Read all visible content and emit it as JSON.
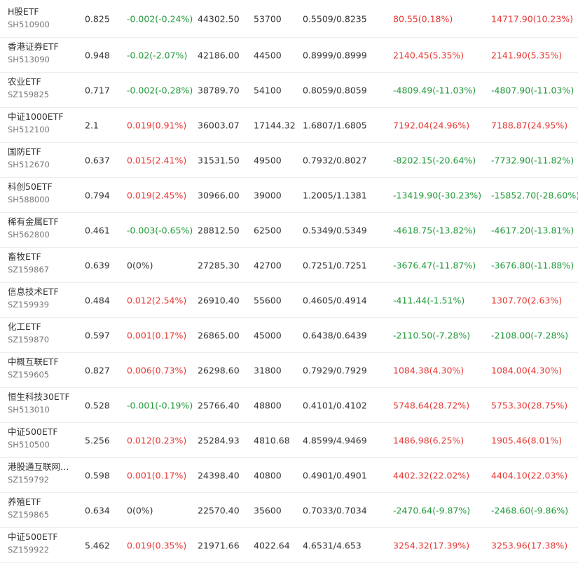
{
  "colors": {
    "up": "#e53935",
    "down": "#229a3a",
    "flat": "#333333",
    "code": "#777777",
    "divider": "#eeeeee"
  },
  "rows": [
    {
      "name": "H股ETF",
      "code": "SH510900",
      "price": "0.825",
      "change": "-0.002(-0.24%)",
      "change_dir": "down",
      "amount": "44302.50",
      "volume": "53700",
      "bid_ask": "0.5509/0.8235",
      "flow1": "80.55(0.18%)",
      "flow1_dir": "up",
      "flow2": "14717.90(10.23%)",
      "flow2_dir": "up"
    },
    {
      "name": "香港证券ETF",
      "code": "SH513090",
      "price": "0.948",
      "change": "-0.02(-2.07%)",
      "change_dir": "down",
      "amount": "42186.00",
      "volume": "44500",
      "bid_ask": "0.8999/0.8999",
      "flow1": "2140.45(5.35%)",
      "flow1_dir": "up",
      "flow2": "2141.90(5.35%)",
      "flow2_dir": "up"
    },
    {
      "name": "农业ETF",
      "code": "SZ159825",
      "price": "0.717",
      "change": "-0.002(-0.28%)",
      "change_dir": "down",
      "amount": "38789.70",
      "volume": "54100",
      "bid_ask": "0.8059/0.8059",
      "flow1": "-4809.49(-11.03%)",
      "flow1_dir": "down",
      "flow2": "-4807.90(-11.03%)",
      "flow2_dir": "down"
    },
    {
      "name": "中证1000ETF",
      "code": "SH512100",
      "price": "2.1",
      "change": "0.019(0.91%)",
      "change_dir": "up",
      "amount": "36003.07",
      "volume": "17144.32",
      "bid_ask": "1.6807/1.6805",
      "flow1": "7192.04(24.96%)",
      "flow1_dir": "up",
      "flow2": "7188.87(24.95%)",
      "flow2_dir": "up"
    },
    {
      "name": "国防ETF",
      "code": "SH512670",
      "price": "0.637",
      "change": "0.015(2.41%)",
      "change_dir": "up",
      "amount": "31531.50",
      "volume": "49500",
      "bid_ask": "0.7932/0.8027",
      "flow1": "-8202.15(-20.64%)",
      "flow1_dir": "down",
      "flow2": "-7732.90(-11.82%)",
      "flow2_dir": "down"
    },
    {
      "name": "科创50ETF",
      "code": "SH588000",
      "price": "0.794",
      "change": "0.019(2.45%)",
      "change_dir": "up",
      "amount": "30966.00",
      "volume": "39000",
      "bid_ask": "1.2005/1.1381",
      "flow1": "-13419.90(-30.23%)",
      "flow1_dir": "down",
      "flow2": "-15852.70(-28.60%)",
      "flow2_dir": "down"
    },
    {
      "name": "稀有金属ETF",
      "code": "SH562800",
      "price": "0.461",
      "change": "-0.003(-0.65%)",
      "change_dir": "down",
      "amount": "28812.50",
      "volume": "62500",
      "bid_ask": "0.5349/0.5349",
      "flow1": "-4618.75(-13.82%)",
      "flow1_dir": "down",
      "flow2": "-4617.20(-13.81%)",
      "flow2_dir": "down"
    },
    {
      "name": "畜牧ETF",
      "code": "SZ159867",
      "price": "0.639",
      "change": "0(0%)",
      "change_dir": "flat",
      "amount": "27285.30",
      "volume": "42700",
      "bid_ask": "0.7251/0.7251",
      "flow1": "-3676.47(-11.87%)",
      "flow1_dir": "down",
      "flow2": "-3676.80(-11.88%)",
      "flow2_dir": "down"
    },
    {
      "name": "信息技术ETF",
      "code": "SZ159939",
      "price": "0.484",
      "change": "0.012(2.54%)",
      "change_dir": "up",
      "amount": "26910.40",
      "volume": "55600",
      "bid_ask": "0.4605/0.4914",
      "flow1": "-411.44(-1.51%)",
      "flow1_dir": "down",
      "flow2": "1307.70(2.63%)",
      "flow2_dir": "up"
    },
    {
      "name": "化工ETF",
      "code": "SZ159870",
      "price": "0.597",
      "change": "0.001(0.17%)",
      "change_dir": "up",
      "amount": "26865.00",
      "volume": "45000",
      "bid_ask": "0.6438/0.6439",
      "flow1": "-2110.50(-7.28%)",
      "flow1_dir": "down",
      "flow2": "-2108.00(-7.28%)",
      "flow2_dir": "down"
    },
    {
      "name": "中概互联ETF",
      "code": "SZ159605",
      "price": "0.827",
      "change": "0.006(0.73%)",
      "change_dir": "up",
      "amount": "26298.60",
      "volume": "31800",
      "bid_ask": "0.7929/0.7929",
      "flow1": "1084.38(4.30%)",
      "flow1_dir": "up",
      "flow2": "1084.00(4.30%)",
      "flow2_dir": "up"
    },
    {
      "name": "恒生科技30ETF",
      "code": "SH513010",
      "price": "0.528",
      "change": "-0.001(-0.19%)",
      "change_dir": "down",
      "amount": "25766.40",
      "volume": "48800",
      "bid_ask": "0.4101/0.4102",
      "flow1": "5748.64(28.72%)",
      "flow1_dir": "up",
      "flow2": "5753.30(28.75%)",
      "flow2_dir": "up"
    },
    {
      "name": "中证500ETF",
      "code": "SH510500",
      "price": "5.256",
      "change": "0.012(0.23%)",
      "change_dir": "up",
      "amount": "25284.93",
      "volume": "4810.68",
      "bid_ask": "4.8599/4.9469",
      "flow1": "1486.98(6.25%)",
      "flow1_dir": "up",
      "flow2": "1905.46(8.01%)",
      "flow2_dir": "up"
    },
    {
      "name": "港股通互联网…",
      "code": "SZ159792",
      "price": "0.598",
      "change": "0.001(0.17%)",
      "change_dir": "up",
      "amount": "24398.40",
      "volume": "40800",
      "bid_ask": "0.4901/0.4901",
      "flow1": "4402.32(22.02%)",
      "flow1_dir": "up",
      "flow2": "4404.10(22.03%)",
      "flow2_dir": "up"
    },
    {
      "name": "养殖ETF",
      "code": "SZ159865",
      "price": "0.634",
      "change": "0(0%)",
      "change_dir": "flat",
      "amount": "22570.40",
      "volume": "35600",
      "bid_ask": "0.7033/0.7034",
      "flow1": "-2470.64(-9.87%)",
      "flow1_dir": "down",
      "flow2": "-2468.60(-9.86%)",
      "flow2_dir": "down"
    },
    {
      "name": "中证500ETF",
      "code": "SZ159922",
      "price": "5.462",
      "change": "0.019(0.35%)",
      "change_dir": "up",
      "amount": "21971.66",
      "volume": "4022.64",
      "bid_ask": "4.6531/4.653",
      "flow1": "3254.32(17.39%)",
      "flow1_dir": "up",
      "flow2": "3253.96(17.38%)",
      "flow2_dir": "up"
    }
  ]
}
